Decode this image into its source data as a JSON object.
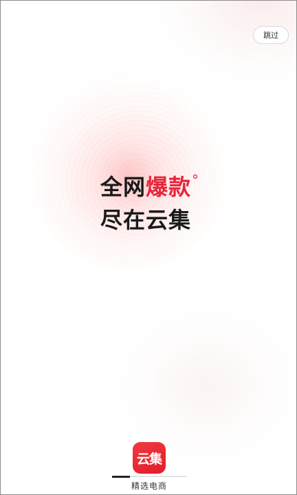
{
  "skip_label": "跳过",
  "slogan": {
    "line1_part1": "全网",
    "line1_part2": "爆款",
    "line1_mark": "°",
    "line2": "尽在云集"
  },
  "logo_text": "云集",
  "tagline": "精选电商",
  "progress_fraction": 0.24,
  "colors": {
    "accent": "#e8243a",
    "logo_bg": "#e21d2c",
    "text": "#1a1a1a"
  }
}
